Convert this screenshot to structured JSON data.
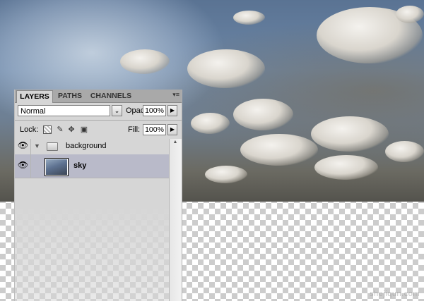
{
  "panel": {
    "tabs": [
      "LAYERS",
      "PATHS",
      "CHANNELS"
    ],
    "menu_icon": "panel-menu-icon",
    "blend_mode": "Normal",
    "opacity_label": "Opacity:",
    "opacity_value": "100%",
    "lock_label": "Lock:",
    "lock_icons": [
      "lock-transparency-icon",
      "lock-paint-icon",
      "lock-move-icon",
      "lock-all-icon"
    ],
    "fill_label": "Fill:",
    "fill_value": "100%",
    "layers": [
      {
        "name": "background",
        "type": "group",
        "visible": true
      },
      {
        "name": "sky",
        "type": "image",
        "visible": true,
        "selected": true
      }
    ]
  },
  "colors": {
    "panel_bg": "#d6d6d6",
    "selected_layer": "#b9bac9",
    "tab_bar": "#a9a9a9"
  },
  "watermark": "shejiqun.com"
}
